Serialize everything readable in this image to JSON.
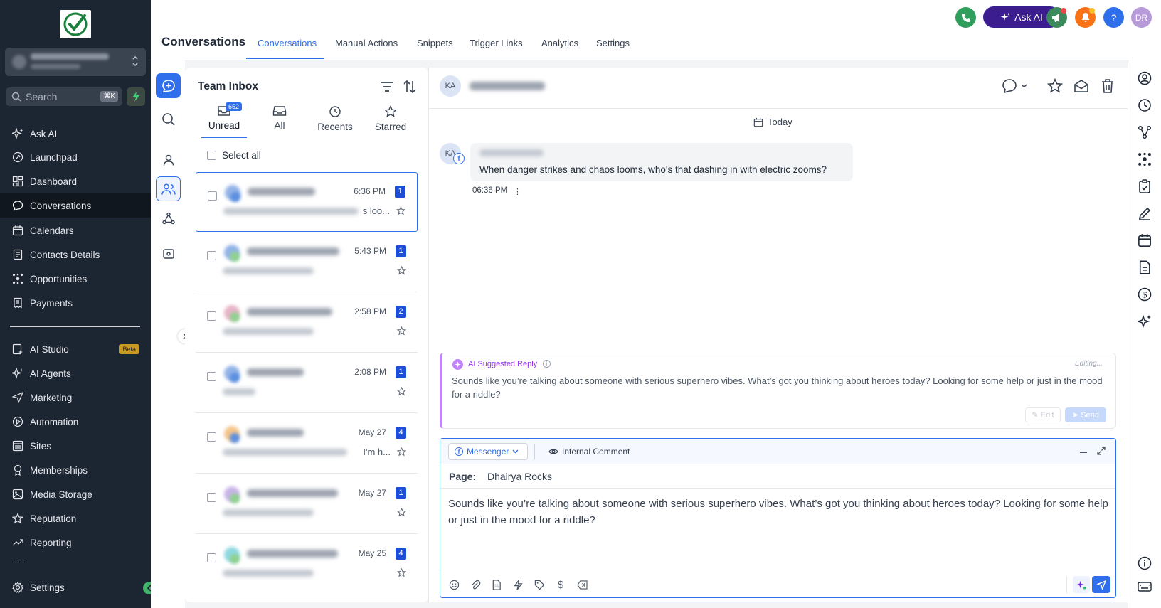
{
  "sidebar": {
    "search_placeholder": "Search",
    "search_shortcut": "⌘K",
    "items": [
      {
        "label": "Ask AI",
        "icon": "sparkle-icon"
      },
      {
        "label": "Launchpad",
        "icon": "rocket-icon"
      },
      {
        "label": "Dashboard",
        "icon": "dashboard-icon"
      },
      {
        "label": "Conversations",
        "icon": "chat-bubble-icon",
        "active": true
      },
      {
        "label": "Calendars",
        "icon": "calendar-icon"
      },
      {
        "label": "Contacts Details",
        "icon": "contacts-icon"
      },
      {
        "label": "Opportunities",
        "icon": "opportunities-icon"
      },
      {
        "label": "Payments",
        "icon": "receipt-icon"
      }
    ],
    "items2": [
      {
        "label": "AI Studio",
        "icon": "ai-studio-icon",
        "badge": "Beta"
      },
      {
        "label": "AI Agents",
        "icon": "sparkle-icon"
      },
      {
        "label": "Marketing",
        "icon": "send-icon"
      },
      {
        "label": "Automation",
        "icon": "automation-icon"
      },
      {
        "label": "Sites",
        "icon": "sites-icon"
      },
      {
        "label": "Memberships",
        "icon": "memberships-icon"
      },
      {
        "label": "Media Storage",
        "icon": "image-icon"
      },
      {
        "label": "Reputation",
        "icon": "star-icon"
      },
      {
        "label": "Reporting",
        "icon": "trending-icon"
      }
    ],
    "settings_label": "Settings"
  },
  "header": {
    "title": "Conversations",
    "tabs": [
      "Conversations",
      "Manual Actions",
      "Snippets",
      "Trigger Links",
      "Analytics",
      "Settings"
    ],
    "ask_ai_label": "Ask AI",
    "help_label": "?",
    "user_initials": "DR"
  },
  "inbox": {
    "title": "Team Inbox",
    "filters": [
      {
        "label": "Unread",
        "count": "652"
      },
      {
        "label": "All"
      },
      {
        "label": "Recents"
      },
      {
        "label": "Starred"
      }
    ],
    "select_all": "Select all",
    "conversations": [
      {
        "time": "6:36 PM",
        "unread": "1",
        "preview_tail": "s loo..."
      },
      {
        "time": "5:43 PM",
        "unread": "1",
        "preview_tail": ""
      },
      {
        "time": "2:58 PM",
        "unread": "2",
        "preview_tail": ""
      },
      {
        "time": "2:08 PM",
        "unread": "1",
        "preview_tail": ""
      },
      {
        "time": "May 27",
        "unread": "4",
        "preview_tail": "I'm h..."
      },
      {
        "time": "May 27",
        "unread": "1",
        "preview_tail": ""
      },
      {
        "time": "May 25",
        "unread": "4",
        "preview_tail": ""
      }
    ]
  },
  "chat": {
    "contact_initials": "KA",
    "date_divider": "Today",
    "message": {
      "text": "When danger strikes and chaos looms, who's that dashing in with electric zooms?",
      "time": "06:36 PM"
    },
    "ai_suggestion": {
      "title": "AI Suggested Reply",
      "status": "Editing...",
      "text": "Sounds like you’re talking about someone with serious superhero vibes. What’s got you thinking about heroes today? Looking for some help or just in the mood for a riddle?",
      "edit_label": "Edit",
      "send_label": "Send"
    },
    "composer": {
      "channel": "Messenger",
      "internal_comment": "Internal Comment",
      "page_label": "Page:",
      "page_value": "Dhairya Rocks",
      "text": "Sounds like you’re talking about someone with serious superhero vibes. What’s got you thinking about heroes today? Looking for some help or just in the mood for a riddle?"
    }
  },
  "colors": {
    "sidebar_bg": "#1c2532",
    "accent": "#2f6feb",
    "unread_badge": "#1d4ed8",
    "ask_ai_bg": "#3b1d8f",
    "ai_purple": "#9333ea"
  }
}
